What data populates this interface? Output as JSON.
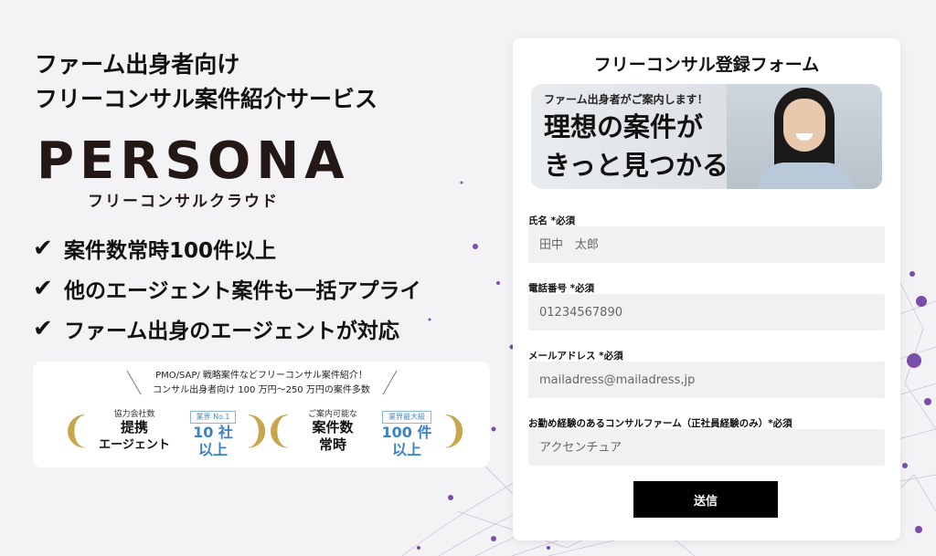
{
  "headline": {
    "line1": "ファーム出身者向け",
    "line2": "フリーコンサル案件紹介サービス"
  },
  "logo": {
    "name": "PERSONA",
    "tagline": "フリーコンサルクラウド"
  },
  "features": [
    {
      "check": "✔",
      "text": "案件数常時100件以上"
    },
    {
      "check": "✔",
      "text": "他のエージェント案件も一括アプライ"
    },
    {
      "check": "✔",
      "text": "ファーム出身のエージェントが対応"
    }
  ],
  "awards": {
    "intro_line1": "PMO/SAP/ 戦略案件などフリーコンサル案件紹介！",
    "intro_line2": "コンサル出身者向け 100 万円〜250 万円の案件多数",
    "items": [
      {
        "small": "協力会社数",
        "title_line1": "提携",
        "title_line2": "エージェント",
        "badge": "業界 No.1",
        "value_line1": "10 社",
        "value_line2": "以上"
      },
      {
        "small": "ご案内可能な",
        "title_line1": "案件数",
        "title_line2": "常時",
        "badge": "業界最大級",
        "value_line1": "100 件",
        "value_line2": "以上"
      }
    ]
  },
  "form": {
    "title": "フリーコンサル登録フォーム",
    "banner_sub": "ファーム出身者がご案内します！",
    "banner_main_line1": "理想の案件が",
    "banner_main_line2": "きっと見つかる",
    "fields": [
      {
        "label": "氏名 *必須",
        "placeholder": "田中　太郎"
      },
      {
        "label": "電話番号 *必須",
        "placeholder": "01234567890"
      },
      {
        "label": "メールアドレス *必須",
        "placeholder": "mailadress@mailadress,jp"
      },
      {
        "label": "お勤め経験のあるコンサルファーム（正社員経験のみ）*必須",
        "placeholder": "アクセンチュア"
      }
    ],
    "submit_label": "送信"
  },
  "colors": {
    "accent_blue": "#3b82c4",
    "gold": "#c9a54c",
    "network_purple": "#7a4fa8"
  }
}
